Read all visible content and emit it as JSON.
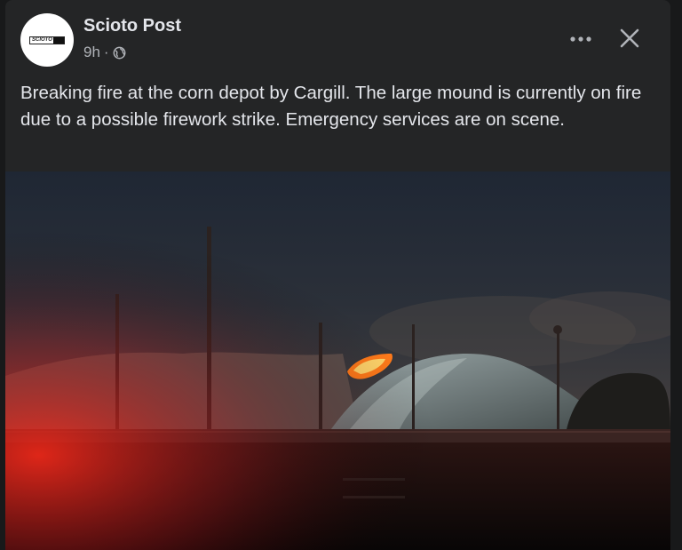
{
  "post": {
    "page_name": "Scioto Post",
    "time": "9h",
    "separator": "·",
    "audience_icon": "globe-icon",
    "text": "Breaking fire at the corn depot by Cargill. The large mound is currently on fire due to a possible firework strike. Emergency services are on scene.",
    "logo_text": "SCIOTO"
  },
  "actions": {
    "more_icon": "more-dots-icon",
    "close_icon": "close-icon"
  },
  "colors": {
    "card_bg": "#242526",
    "page_bg": "#18191a",
    "text_primary": "#e4e6eb",
    "text_secondary": "#b0b3b8"
  }
}
